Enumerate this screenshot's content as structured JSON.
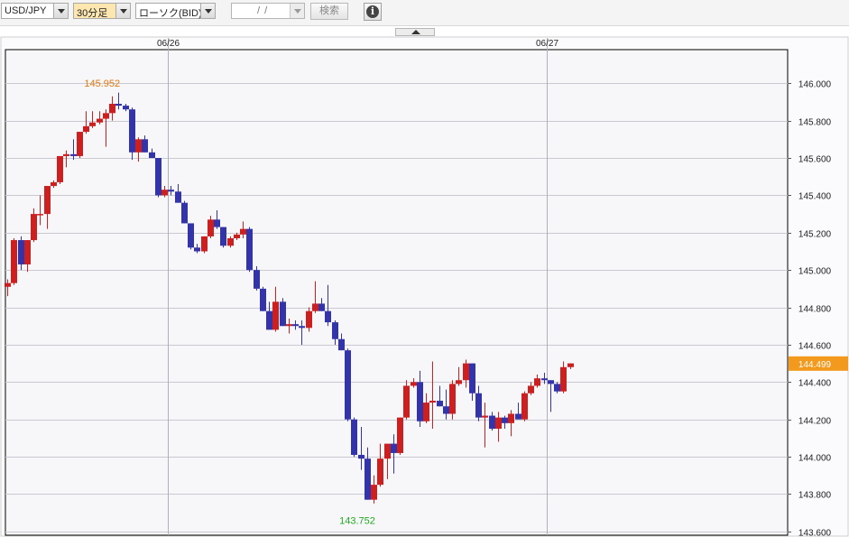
{
  "toolbar": {
    "symbol": "USD/JPY",
    "interval": "30分足",
    "chart_type": "ローソク(BID)",
    "date_placeholder": "/ /",
    "search_label": "検索",
    "info_icon": "info-icon",
    "collapse_icon": "caret-up-icon"
  },
  "colors": {
    "up": "#cc1f1f",
    "down": "#3333aa",
    "high_label": "#e07a10",
    "low_label": "#22aa22",
    "current_price_bg": "#f39a1e"
  },
  "chart_data": {
    "type": "candlestick",
    "symbol": "USD/JPY",
    "interval": "30分足",
    "date_labels": [
      "06/26",
      "06/27"
    ],
    "y_ticks": [
      "146.000",
      "145.800",
      "145.600",
      "145.400",
      "145.200",
      "145.000",
      "144.800",
      "144.600",
      "144.400",
      "144.200",
      "144.000",
      "143.800",
      "143.600"
    ],
    "ylim": [
      143.58,
      146.18
    ],
    "grid": true,
    "high": {
      "value": 145.952,
      "label": "145.952"
    },
    "low": {
      "value": 143.752,
      "label": "143.752"
    },
    "current_price": {
      "value": 144.499,
      "label": "144.499"
    },
    "candles": [
      [
        144.91,
        144.95,
        144.86,
        144.93
      ],
      [
        144.93,
        145.17,
        144.92,
        145.16
      ],
      [
        145.16,
        145.18,
        145.0,
        145.03
      ],
      [
        145.03,
        145.16,
        144.99,
        145.16
      ],
      [
        145.16,
        145.33,
        145.15,
        145.3
      ],
      [
        145.3,
        145.4,
        145.24,
        145.3
      ],
      [
        145.3,
        145.45,
        145.22,
        145.45
      ],
      [
        145.45,
        145.48,
        145.44,
        145.47
      ],
      [
        145.47,
        145.61,
        145.46,
        145.61
      ],
      [
        145.61,
        145.64,
        145.55,
        145.62
      ],
      [
        145.62,
        145.7,
        145.59,
        145.61
      ],
      [
        145.61,
        145.74,
        145.6,
        145.74
      ],
      [
        145.74,
        145.85,
        145.73,
        145.77
      ],
      [
        145.77,
        145.85,
        145.76,
        145.79
      ],
      [
        145.79,
        145.85,
        145.78,
        145.81
      ],
      [
        145.81,
        145.86,
        145.66,
        145.84
      ],
      [
        145.84,
        145.93,
        145.8,
        145.89
      ],
      [
        145.89,
        145.95,
        145.86,
        145.88
      ],
      [
        145.88,
        145.89,
        145.85,
        145.86
      ],
      [
        145.86,
        145.87,
        145.59,
        145.63
      ],
      [
        145.63,
        145.71,
        145.58,
        145.7
      ],
      [
        145.7,
        145.72,
        145.63,
        145.63
      ],
      [
        145.63,
        145.65,
        145.6,
        145.6
      ],
      [
        145.6,
        145.6,
        145.39,
        145.4
      ],
      [
        145.4,
        145.45,
        145.39,
        145.43
      ],
      [
        145.43,
        145.45,
        145.4,
        145.42
      ],
      [
        145.42,
        145.46,
        145.36,
        145.36
      ],
      [
        145.36,
        145.37,
        145.25,
        145.25
      ],
      [
        145.25,
        145.25,
        145.11,
        145.12
      ],
      [
        145.12,
        145.14,
        145.09,
        145.1
      ],
      [
        145.1,
        145.18,
        145.09,
        145.18
      ],
      [
        145.18,
        145.29,
        145.17,
        145.27
      ],
      [
        145.27,
        145.32,
        145.22,
        145.23
      ],
      [
        145.23,
        145.23,
        145.12,
        145.13
      ],
      [
        145.13,
        145.18,
        145.12,
        145.17
      ],
      [
        145.17,
        145.2,
        145.16,
        145.19
      ],
      [
        145.19,
        145.26,
        145.17,
        145.22
      ],
      [
        145.22,
        145.23,
        144.99,
        145.0
      ],
      [
        145.0,
        145.02,
        144.89,
        144.9
      ],
      [
        144.9,
        144.91,
        144.78,
        144.78
      ],
      [
        144.78,
        144.83,
        144.68,
        144.68
      ],
      [
        144.68,
        144.91,
        144.67,
        144.83
      ],
      [
        144.83,
        144.85,
        144.7,
        144.7
      ],
      [
        144.7,
        144.74,
        144.66,
        144.71
      ],
      [
        144.71,
        144.73,
        144.68,
        144.7
      ],
      [
        144.7,
        144.73,
        144.6,
        144.69
      ],
      [
        144.69,
        144.8,
        144.67,
        144.78
      ],
      [
        144.78,
        144.94,
        144.77,
        144.82
      ],
      [
        144.82,
        144.85,
        144.78,
        144.78
      ],
      [
        144.78,
        144.92,
        144.7,
        144.72
      ],
      [
        144.72,
        144.73,
        144.6,
        144.63
      ],
      [
        144.63,
        144.66,
        144.57,
        144.57
      ],
      [
        144.57,
        144.58,
        144.19,
        144.2
      ],
      [
        144.2,
        144.21,
        144.0,
        144.01
      ],
      [
        144.01,
        144.16,
        143.93,
        143.99
      ],
      [
        143.99,
        144.05,
        143.77,
        143.77
      ],
      [
        143.77,
        143.9,
        143.75,
        143.85
      ],
      [
        143.85,
        144.07,
        143.84,
        143.99
      ],
      [
        143.99,
        144.05,
        143.88,
        144.07
      ],
      [
        144.07,
        144.12,
        143.91,
        144.02
      ],
      [
        144.02,
        144.21,
        144.01,
        144.21
      ],
      [
        144.21,
        144.41,
        144.2,
        144.38
      ],
      [
        144.38,
        144.42,
        144.37,
        144.4
      ],
      [
        144.4,
        144.46,
        144.16,
        144.19
      ],
      [
        144.19,
        144.34,
        144.18,
        144.29
      ],
      [
        144.29,
        144.51,
        144.15,
        144.3
      ],
      [
        144.3,
        144.38,
        144.27,
        144.27
      ],
      [
        144.27,
        144.36,
        144.2,
        144.23
      ],
      [
        144.23,
        144.41,
        144.2,
        144.39
      ],
      [
        144.39,
        144.48,
        144.38,
        144.41
      ],
      [
        144.41,
        144.52,
        144.37,
        144.5
      ],
      [
        144.5,
        144.5,
        144.3,
        144.34
      ],
      [
        144.34,
        144.38,
        144.19,
        144.21
      ],
      [
        144.21,
        144.29,
        144.05,
        144.22
      ],
      [
        144.22,
        144.24,
        144.14,
        144.15
      ],
      [
        144.15,
        144.24,
        144.08,
        144.21
      ],
      [
        144.21,
        144.22,
        144.15,
        144.18
      ],
      [
        144.18,
        144.25,
        144.11,
        144.23
      ],
      [
        144.23,
        144.29,
        144.2,
        144.2
      ],
      [
        144.2,
        144.35,
        144.19,
        144.34
      ],
      [
        144.34,
        144.4,
        144.33,
        144.38
      ],
      [
        144.38,
        144.44,
        144.37,
        144.42
      ],
      [
        144.42,
        144.45,
        144.39,
        144.41
      ],
      [
        144.41,
        144.41,
        144.24,
        144.39
      ],
      [
        144.39,
        144.4,
        144.34,
        144.35
      ],
      [
        144.35,
        144.51,
        144.34,
        144.48
      ],
      [
        144.48,
        144.5,
        144.47,
        144.5
      ]
    ]
  }
}
